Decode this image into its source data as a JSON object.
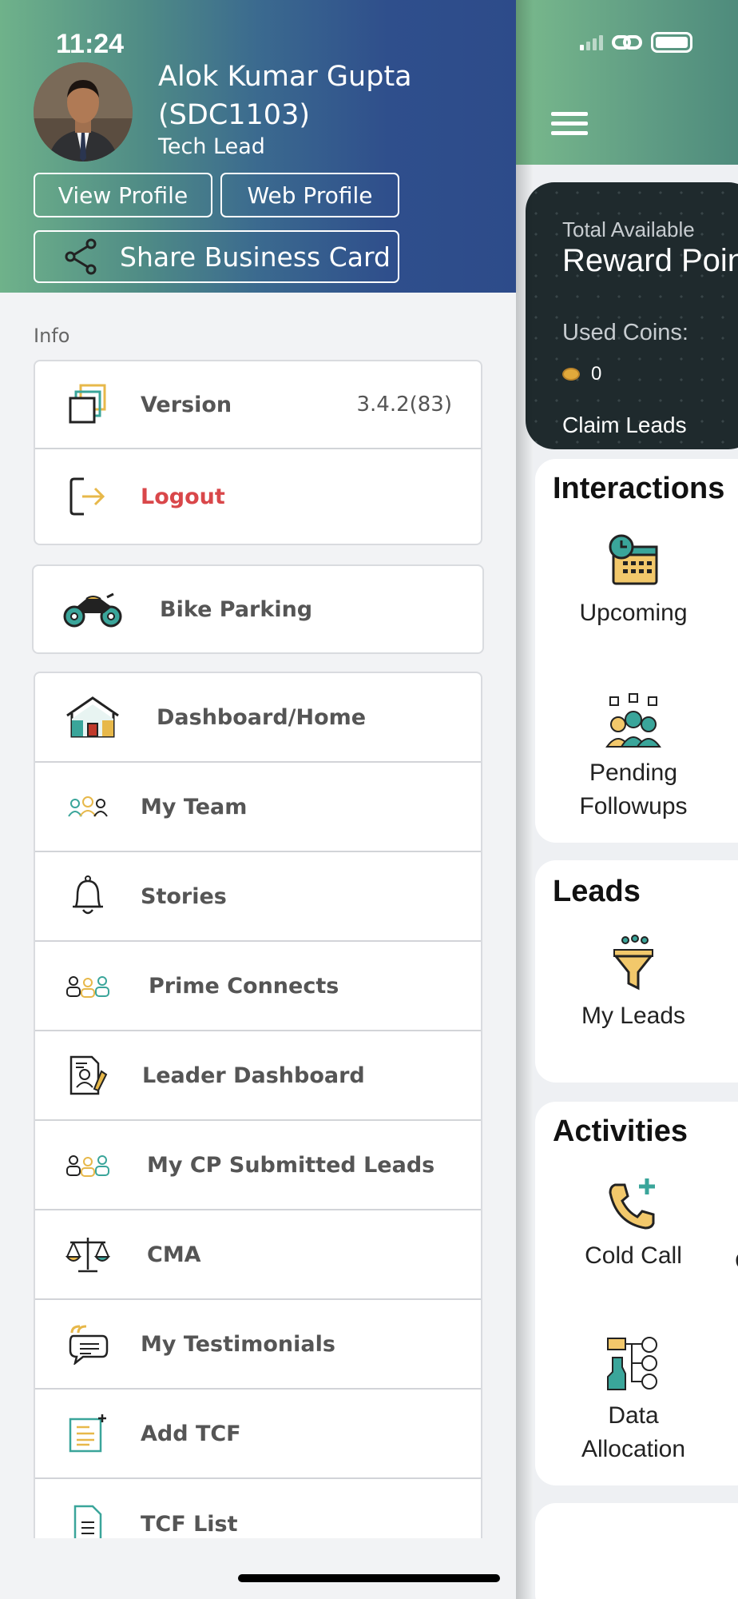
{
  "status_bar": {
    "time": "11:24"
  },
  "profile": {
    "name": "Alok Kumar Gupta (SDC1103)",
    "role": "Tech Lead",
    "view_profile": "View Profile",
    "web_profile": "Web Profile",
    "share_card": "Share Business Card"
  },
  "info_section": {
    "label": "Info"
  },
  "info_items": [
    {
      "label": "Version",
      "value": "3.4.2(83)",
      "icon": "layers-icon"
    },
    {
      "label": "Logout",
      "icon": "logout-icon"
    }
  ],
  "bike_item": {
    "label": "Bike Parking",
    "icon": "motorbike-icon"
  },
  "menu_items": [
    {
      "label": "Dashboard/Home",
      "icon": "home-icon"
    },
    {
      "label": "My Team",
      "icon": "team-icon"
    },
    {
      "label": "Stories",
      "icon": "bell-icon"
    },
    {
      "label": "Prime Connects",
      "icon": "people-icon"
    },
    {
      "label": "Leader Dashboard",
      "icon": "document-pen-icon"
    },
    {
      "label": "My CP Submitted Leads",
      "icon": "people-icon"
    },
    {
      "label": "CMA",
      "icon": "scale-icon"
    },
    {
      "label": "My Testimonials",
      "icon": "quote-chat-icon"
    },
    {
      "label": "Add TCF",
      "icon": "add-document-icon"
    },
    {
      "label": "TCF List",
      "icon": "list-document-icon"
    }
  ],
  "app": {
    "reward": {
      "total_label": "Total Available",
      "title": "Reward Poin",
      "used_label": "Used Coins:",
      "used_value": "0",
      "claim_label": "Claim Leads"
    },
    "interactions": {
      "title": "Interactions",
      "tiles": [
        {
          "label": "Upcoming",
          "icon": "calendar-clock-icon"
        },
        {
          "label": "Pending\nFollowups",
          "icon": "team-meeting-icon"
        }
      ]
    },
    "leads": {
      "title": "Leads",
      "tiles": [
        {
          "label": "My Leads",
          "icon": "funnel-icon"
        }
      ]
    },
    "activities": {
      "title": "Activities",
      "tiles": [
        {
          "label": "Cold Call",
          "icon": "phone-plus-icon"
        },
        {
          "label": "Data\nAllocation",
          "icon": "data-allocation-icon"
        }
      ],
      "cut_label": "Co"
    }
  },
  "colors": {
    "accent_green": "#79b98c",
    "header_blue": "#2d4b8a",
    "logout_red": "#d9474a",
    "icon_teal": "#3aa59a",
    "icon_yellow": "#e7b84a"
  }
}
